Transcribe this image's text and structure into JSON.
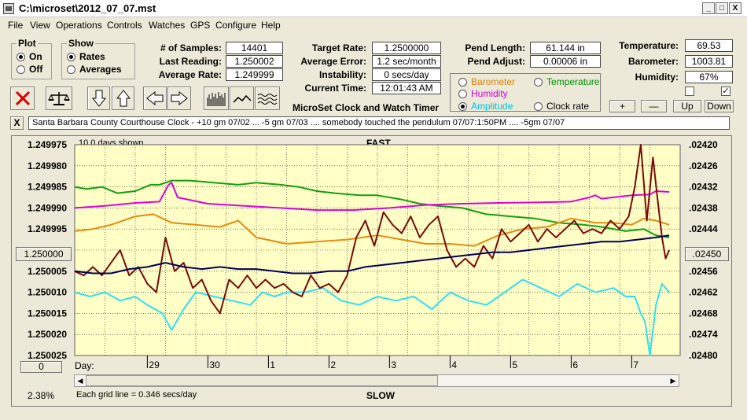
{
  "window": {
    "title": "C:\\microset\\2012_07_07.mst",
    "minimize_glyph": "_",
    "maximize_glyph": "□",
    "close_glyph": "X"
  },
  "menu": [
    "File",
    "View",
    "Operations",
    "Controls",
    "Watches",
    "GPS",
    "Configure",
    "Help"
  ],
  "plot_group": {
    "title": "Plot",
    "options": [
      "On",
      "Off"
    ],
    "selected": 0
  },
  "show_group": {
    "title": "Show",
    "options": [
      "Rates",
      "Averages"
    ],
    "selected": 0
  },
  "stats_left": [
    {
      "label": "# of Samples:",
      "value": "14401"
    },
    {
      "label": "Last Reading:",
      "value": "1.250002"
    },
    {
      "label": "Average Rate:",
      "value": "1.249999"
    }
  ],
  "stats_mid": [
    {
      "label": "Target Rate:",
      "value": "1.2500000"
    },
    {
      "label": "Average Error:",
      "value": "1.2 sec/month"
    },
    {
      "label": "Instability:",
      "value": "0 secs/day"
    },
    {
      "label": "Current Time:",
      "value": "12:01:43 AM"
    }
  ],
  "pend": [
    {
      "label": "Pend Length:",
      "value": "61.144 in"
    },
    {
      "label": "Pend Adjust:",
      "value": "0.00006 in"
    }
  ],
  "sensors": [
    {
      "label": "Temperature:",
      "value": "69.53"
    },
    {
      "label": "Barometer:",
      "value": "1003.81"
    },
    {
      "label": "Humidity:",
      "value": "67%"
    }
  ],
  "series_select": {
    "options": [
      {
        "label": "Barometer",
        "color": "#e08000"
      },
      {
        "label": "Temperature",
        "color": "#009000"
      },
      {
        "label": "Humidity",
        "color": "#d000d0"
      },
      {
        "label": "Amplitude",
        "color": "#00c0e0"
      },
      {
        "label": "Clock rate",
        "color": "#000000"
      }
    ],
    "selected": 3
  },
  "app_title": "MicroSet Clock and Watch Timer",
  "zoom_buttons": [
    "+",
    "—",
    "Up",
    "Down"
  ],
  "checkboxes": [
    false,
    true
  ],
  "check_glyph": "✓",
  "notes_close": "X",
  "notes": "Santa Barbara County Courthouse Clock -   +10 gm 07/02 ... -5 gm 07/03  .... somebody touched the pendulum 07/07:1:50PM  ....  -5gm 07/07",
  "chart_meta": {
    "days_shown": "10.0 days shown",
    "top_label": "FAST",
    "bottom_label": "SLOW",
    "day_prefix": "Day:",
    "grid_note": "Each grid line = 0.346 secs/day",
    "percent": "2.38%",
    "center_left": "1.250000",
    "center_right": ".02450",
    "zero_button": "0"
  },
  "chart_data": {
    "type": "line",
    "x_ticks": [
      "29",
      "30",
      "1",
      "2",
      "3",
      "4",
      "5",
      "6",
      "7"
    ],
    "y_ticks_left": [
      "1.249975",
      "1.249980",
      "1.249985",
      "1.249990",
      "1.249995",
      "1.250000",
      "1.250005",
      "1.250010",
      "1.250015",
      "1.250020",
      "1.250025"
    ],
    "y_ticks_right": [
      ".02420",
      ".02426",
      ".02432",
      ".02438",
      ".02444",
      ".02450",
      ".02456",
      ".02462",
      ".02468",
      ".02474",
      ".02480"
    ],
    "ylim_left": [
      1.250025,
      1.249975
    ],
    "ylim_right": [
      0.0248,
      0.0242
    ],
    "xlim_days": [
      0,
      10
    ],
    "grid": true,
    "series": [
      {
        "color": "#10a010",
        "x": [
          0,
          0.2,
          0.45,
          0.7,
          1.0,
          1.25,
          1.4,
          1.6,
          1.9,
          2.3,
          2.7,
          3.0,
          3.4,
          3.7,
          4.0,
          4.3,
          4.7,
          5.0,
          5.4,
          5.7,
          6.0,
          6.4,
          6.8,
          7.2,
          7.6,
          8.0,
          8.4,
          8.7,
          9.1,
          9.4,
          9.6,
          9.82
        ],
        "y": [
          1.249985,
          1.2499855,
          1.249985,
          1.2499865,
          1.249986,
          1.2499845,
          1.2499845,
          1.2499835,
          1.2499835,
          1.249984,
          1.2499845,
          1.249984,
          1.2499845,
          1.249985,
          1.249986,
          1.2499865,
          1.249987,
          1.249987,
          1.249988,
          1.249989,
          1.2499895,
          1.24999,
          1.2499915,
          1.249992,
          1.2499925,
          1.2499935,
          1.249994,
          1.2499945,
          1.2499955,
          1.249995,
          1.2499965,
          1.249997
        ]
      },
      {
        "color": "#e000e0",
        "x": [
          0,
          0.5,
          1.0,
          1.4,
          1.55,
          1.6,
          1.7,
          2.2,
          2.8,
          3.4,
          4.0,
          4.6,
          5.2,
          5.8,
          6.4,
          7.0,
          7.6,
          8.2,
          8.5,
          8.6,
          8.7,
          9.2,
          9.5,
          9.6,
          9.82
        ],
        "y": [
          1.24999,
          1.2499895,
          1.2499888,
          1.2499885,
          1.2499845,
          1.249984,
          1.2499875,
          1.249989,
          1.2499895,
          1.24999,
          1.2499905,
          1.2499905,
          1.24999,
          1.2499893,
          1.249989,
          1.2499888,
          1.2499887,
          1.2499885,
          1.2499875,
          1.249987,
          1.2499878,
          1.249987,
          1.2499868,
          1.249986,
          1.2499862
        ]
      },
      {
        "color": "#e88a10",
        "x": [
          0,
          0.3,
          0.6,
          1.0,
          1.3,
          1.6,
          2.0,
          2.4,
          2.7,
          3.0,
          3.5,
          4.0,
          4.5,
          5.0,
          5.4,
          5.8,
          6.2,
          6.6,
          7.0,
          7.4,
          7.8,
          8.2,
          8.6,
          8.9,
          9.2,
          9.4,
          9.6,
          9.82
        ],
        "y": [
          1.2499955,
          1.249995,
          1.249994,
          1.249992,
          1.2499915,
          1.2499935,
          1.249994,
          1.2499945,
          1.249993,
          1.249997,
          1.2499985,
          1.249998,
          1.2499975,
          1.2499965,
          1.2499975,
          1.2499985,
          1.2499985,
          1.249999,
          1.2499965,
          1.249995,
          1.2499945,
          1.2499925,
          1.2499935,
          1.2499935,
          1.249994,
          1.2499925,
          1.249993,
          1.249994
        ]
      },
      {
        "color": "#30e0f0",
        "x": [
          0,
          0.25,
          0.5,
          0.75,
          1.0,
          1.2,
          1.45,
          1.6,
          1.8,
          2.0,
          2.3,
          2.6,
          2.9,
          3.1,
          3.3,
          3.5,
          3.8,
          4.1,
          4.4,
          4.7,
          5.0,
          5.3,
          5.6,
          5.9,
          6.2,
          6.5,
          6.8,
          7.1,
          7.4,
          7.7,
          8.0,
          8.3,
          8.6,
          8.9,
          9.1,
          9.25,
          9.35,
          9.42,
          9.5,
          9.6,
          9.7,
          9.82
        ],
        "y": [
          1.25001,
          1.250011,
          1.25001,
          1.250012,
          1.250011,
          1.250013,
          1.250015,
          1.250019,
          1.250014,
          1.25001,
          1.250011,
          1.250012,
          1.250013,
          1.25001,
          1.250011,
          1.25001,
          1.25001,
          1.250009,
          1.250012,
          1.250013,
          1.250011,
          1.250012,
          1.250011,
          1.250014,
          1.25001,
          1.250012,
          1.250013,
          1.25001,
          1.250007,
          1.250009,
          1.250011,
          1.250008,
          1.25001,
          1.250009,
          1.250011,
          1.250011,
          1.250015,
          1.250017,
          1.250025,
          1.250013,
          1.250008,
          1.25001
        ]
      },
      {
        "color": "#7a0a0a",
        "x": [
          0,
          0.15,
          0.3,
          0.45,
          0.6,
          0.75,
          0.9,
          1.05,
          1.2,
          1.35,
          1.5,
          1.65,
          1.8,
          1.95,
          2.1,
          2.25,
          2.4,
          2.55,
          2.7,
          2.85,
          3.0,
          3.15,
          3.3,
          3.45,
          3.6,
          3.75,
          3.9,
          4.05,
          4.2,
          4.35,
          4.5,
          4.65,
          4.8,
          4.95,
          5.1,
          5.25,
          5.4,
          5.55,
          5.7,
          5.85,
          6.0,
          6.15,
          6.3,
          6.45,
          6.6,
          6.75,
          6.9,
          7.05,
          7.2,
          7.35,
          7.5,
          7.65,
          7.8,
          7.95,
          8.1,
          8.25,
          8.4,
          8.55,
          8.7,
          8.85,
          9.0,
          9.15,
          9.25,
          9.35,
          9.45,
          9.55,
          9.62,
          9.7,
          9.76,
          9.82
        ],
        "y": [
          1.250005,
          1.250006,
          1.250004,
          1.250006,
          1.250003,
          1.25,
          1.250006,
          1.250004,
          1.250008,
          1.25001,
          1.249997,
          1.250005,
          1.250003,
          1.250009,
          1.250007,
          1.250012,
          1.250015,
          1.250007,
          1.250009,
          1.250006,
          1.250009,
          1.250007,
          1.250009,
          1.250008,
          1.25001,
          1.250011,
          1.250006,
          1.250009,
          1.250008,
          1.25001,
          1.250006,
          1.249997,
          1.249993,
          1.249999,
          1.249991,
          1.249994,
          1.249996,
          1.249992,
          1.249997,
          1.249994,
          1.249992,
          1.25,
          1.250004,
          1.250002,
          1.250004,
          1.249999,
          1.250002,
          1.249995,
          1.249998,
          1.249996,
          1.249994,
          1.249998,
          1.249995,
          1.249997,
          1.249995,
          1.249993,
          1.249996,
          1.249995,
          1.249996,
          1.249993,
          1.249995,
          1.249992,
          1.249985,
          1.249975,
          1.249993,
          1.249978,
          1.249987,
          1.249997,
          1.250002,
          1.25
        ]
      },
      {
        "color": "#00005a",
        "x": [
          0,
          0.3,
          0.6,
          0.9,
          1.2,
          1.5,
          1.8,
          2.1,
          2.4,
          2.7,
          3.0,
          3.3,
          3.6,
          3.9,
          4.2,
          4.5,
          4.8,
          5.1,
          5.4,
          5.7,
          6.0,
          6.3,
          6.6,
          6.9,
          7.2,
          7.5,
          7.8,
          8.1,
          8.4,
          8.7,
          9.0,
          9.3,
          9.6,
          9.82
        ],
        "y": [
          1.250005,
          1.2500055,
          1.2500055,
          1.2500045,
          1.250004,
          1.250003,
          1.250004,
          1.2500045,
          1.250004,
          1.2500045,
          1.2500045,
          1.250005,
          1.2500055,
          1.2500055,
          1.250005,
          1.250005,
          1.250004,
          1.2500035,
          1.250003,
          1.2500025,
          1.250002,
          1.2500015,
          1.250001,
          1.2500005,
          1.2500005,
          1.25,
          1.2499995,
          1.249999,
          1.2499985,
          1.249998,
          1.249998,
          1.2499975,
          1.249997,
          1.2499965
        ]
      }
    ]
  }
}
